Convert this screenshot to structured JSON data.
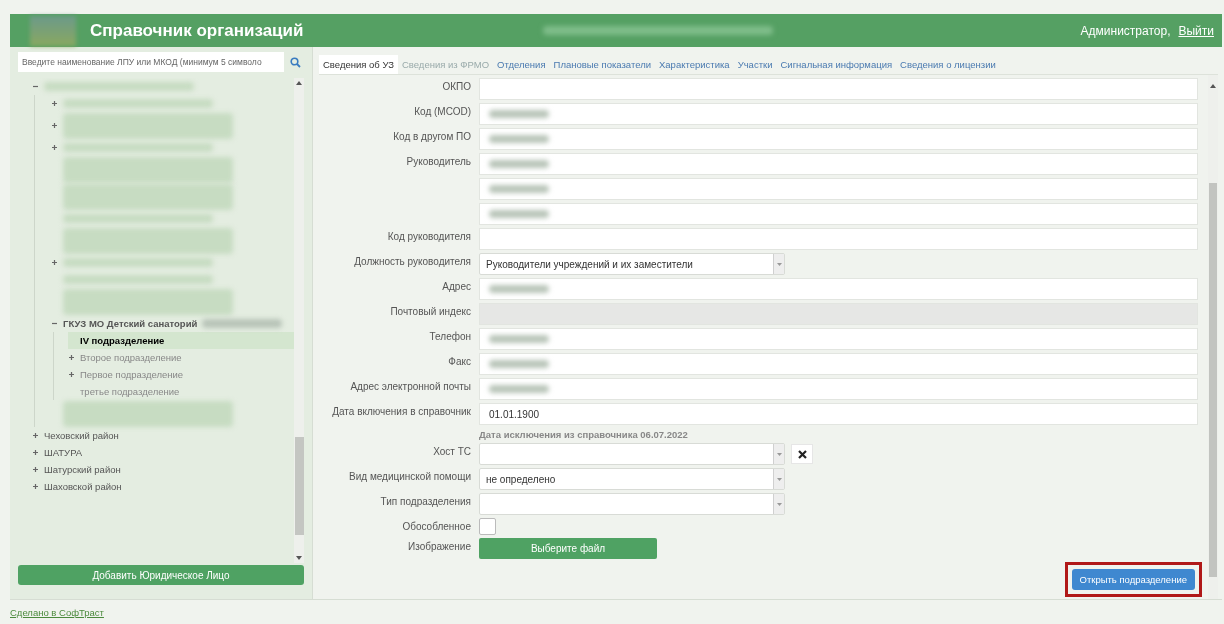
{
  "header": {
    "title": "Справочник организаций",
    "user": "Администратор,",
    "logout": "Выйти"
  },
  "sidebar": {
    "search": {
      "placeholder": "Введите наименование ЛПУ или МКОД (минимум 5 символо"
    },
    "tree": [
      {
        "kind": "blurred",
        "expandable": true,
        "expanded": true,
        "selected": false,
        "children": [
          {
            "kind": "blurred",
            "expandable": true,
            "selected": false
          },
          {
            "kind": "blurred2",
            "expandable": true,
            "selected": false
          },
          {
            "kind": "blurred",
            "expandable": true,
            "selected": false
          },
          {
            "kind": "blurred2",
            "expandable": false,
            "selected": false
          },
          {
            "kind": "blurred2",
            "expandable": false,
            "selected": false
          },
          {
            "kind": "blurred",
            "expandable": false,
            "selected": false
          },
          {
            "kind": "blurred2",
            "expandable": false,
            "selected": false
          },
          {
            "kind": "blurred",
            "expandable": true,
            "selected": false
          },
          {
            "kind": "blurred",
            "expandable": false,
            "selected": false
          },
          {
            "kind": "blurred2",
            "expandable": false,
            "selected": false
          },
          {
            "kind": "text",
            "label": "ГКУЗ МО Детский санаторий",
            "blurred_suffix": true,
            "expandable": true,
            "expanded": true,
            "selected": false,
            "children": [
              {
                "kind": "text",
                "label": "IV подразделение",
                "expandable": false,
                "selected": true
              },
              {
                "kind": "text",
                "label": "Второе подразделение",
                "expandable": true,
                "selected": false
              },
              {
                "kind": "text",
                "label": "Первое подразделение",
                "expandable": true,
                "selected": false
              },
              {
                "kind": "text",
                "label": "третье подразделение",
                "expandable": false,
                "selected": false
              }
            ]
          },
          {
            "kind": "blurred2",
            "expandable": false,
            "selected": false
          }
        ]
      },
      {
        "kind": "text",
        "label": "Чеховский район",
        "expandable": true,
        "selected": false
      },
      {
        "kind": "text",
        "label": "ШАТУРА",
        "expandable": true,
        "selected": false
      },
      {
        "kind": "text",
        "label": "Шатурский район",
        "expandable": true,
        "selected": false
      },
      {
        "kind": "text",
        "label": "Шаховской район",
        "expandable": true,
        "selected": false
      }
    ],
    "add_button": "Добавить Юридическое Лицо"
  },
  "tabs": [
    {
      "label": "Сведения об УЗ",
      "selected": true,
      "disabled": false
    },
    {
      "label": "Сведения из ФРМО",
      "selected": false,
      "disabled": true
    },
    {
      "label": "Отделения",
      "selected": false,
      "disabled": false
    },
    {
      "label": "Плановые показатели",
      "selected": false,
      "disabled": false
    },
    {
      "label": "Характеристика",
      "selected": false,
      "disabled": false
    },
    {
      "label": "Участки",
      "selected": false,
      "disabled": false
    },
    {
      "label": "Сигнальная информация",
      "selected": false,
      "disabled": false
    },
    {
      "label": "Сведения о лицензии",
      "selected": false,
      "disabled": false
    }
  ],
  "form": [
    {
      "kind": "input",
      "label": "ОКПО",
      "blurred": false,
      "disabled": false
    },
    {
      "kind": "input",
      "label": "Код (МСОD)",
      "blurred": true,
      "disabled": false
    },
    {
      "kind": "input",
      "label": "Код в другом ПО",
      "blurred": true,
      "disabled": false
    },
    {
      "kind": "input",
      "label": "Руководитель",
      "blurred": true,
      "disabled": false
    },
    {
      "kind": "input",
      "blurred": true,
      "disabled": false
    },
    {
      "kind": "input",
      "blurred": true,
      "disabled": false
    },
    {
      "kind": "input",
      "label": "Код руководителя",
      "blurred": false,
      "disabled": false
    },
    {
      "kind": "select",
      "label": "Должность руководителя",
      "value": "Руководители учреждений и их заместители",
      "clearable": false
    },
    {
      "kind": "input",
      "label": "Адрес",
      "blurred": true,
      "disabled": false
    },
    {
      "kind": "input",
      "label": "Почтовый индекс",
      "blurred": false,
      "disabled": true
    },
    {
      "kind": "input",
      "label": "Телефон",
      "blurred": true,
      "disabled": false
    },
    {
      "kind": "input",
      "label": "Факс",
      "blurred": true,
      "disabled": false
    },
    {
      "kind": "input",
      "label": "Адрес электронной почты",
      "blurred": true,
      "disabled": false
    },
    {
      "kind": "input",
      "label": "Дата включения в справочник",
      "value": "01.01.1900",
      "blurred": false,
      "disabled": false,
      "note": "Дата исключения из справочника 06.07.2022"
    },
    {
      "kind": "select",
      "label": "Хост ТС",
      "clearable": true
    },
    {
      "kind": "select",
      "label": "Вид медицинской помощи",
      "value": "не определено",
      "clearable": false
    },
    {
      "kind": "select",
      "label": "Тип подразделения",
      "clearable": false
    },
    {
      "kind": "checkbox",
      "label": "Обособленное",
      "checked": false
    },
    {
      "kind": "file",
      "label": "Изображение",
      "button": "Выберите файл"
    }
  ],
  "open_button": {
    "label": "Открыть подразделение",
    "highlighted": true
  },
  "footer": "Сделано в СофТраст"
}
